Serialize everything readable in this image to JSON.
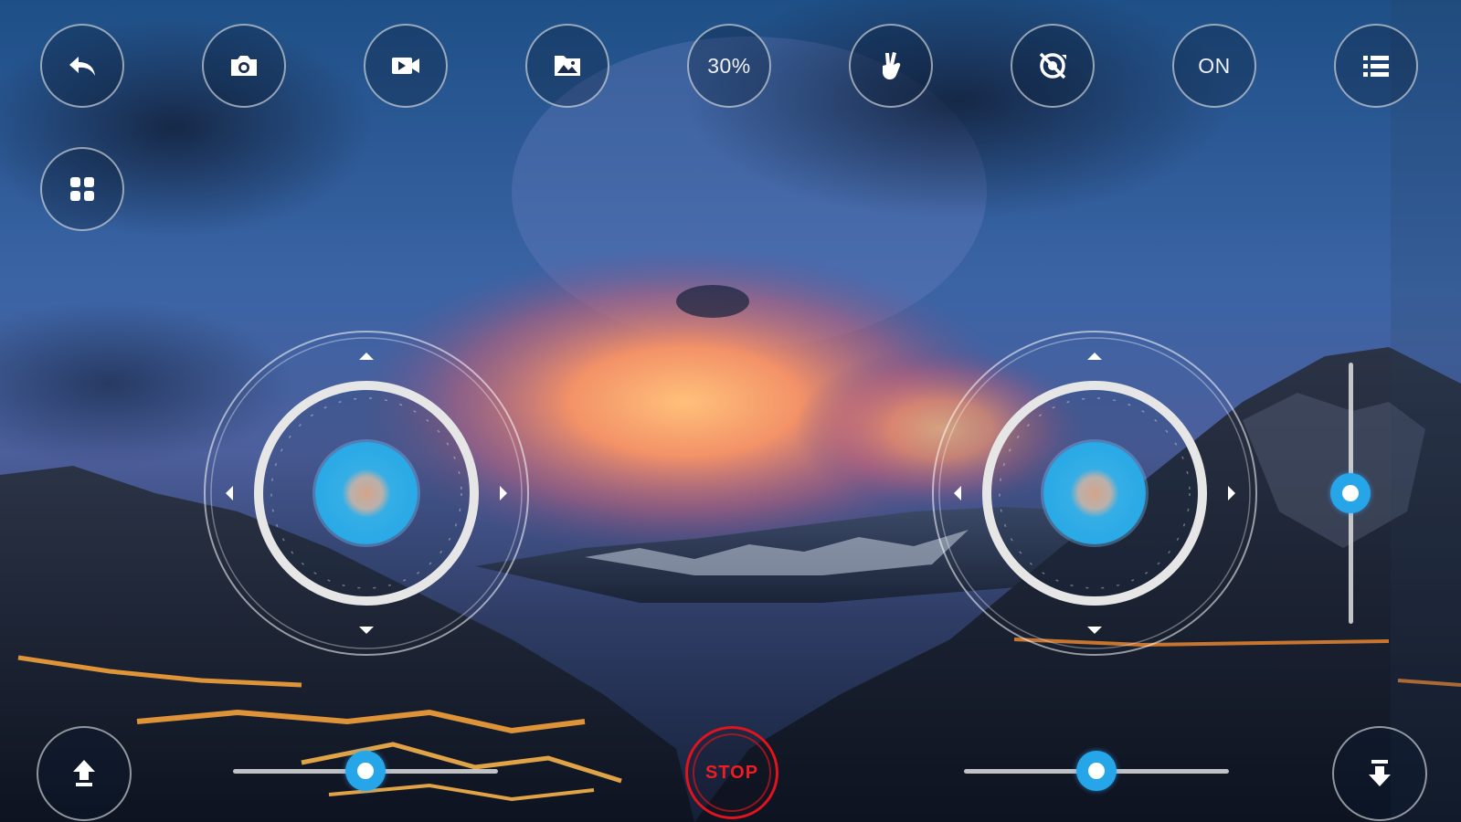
{
  "toolbar": {
    "back": {
      "icon": "back-arrow-icon"
    },
    "photo": {
      "icon": "camera-icon"
    },
    "video": {
      "icon": "video-camera-icon"
    },
    "gallery": {
      "icon": "gallery-folder-icon"
    },
    "speed": {
      "label": "30%"
    },
    "gesture": {
      "icon": "gesture-hand-icon"
    },
    "gyro": {
      "icon": "headless-mode-icon"
    },
    "power": {
      "label": "ON"
    },
    "menu": {
      "icon": "menu-list-icon"
    }
  },
  "side": {
    "grid": {
      "icon": "grid-apps-icon"
    }
  },
  "controls": {
    "takeoff": {
      "icon": "takeoff-up-icon"
    },
    "land": {
      "icon": "land-down-icon"
    },
    "stop": {
      "label": "STOP"
    },
    "left_trim_value": 0.5,
    "right_trim_value": 0.5,
    "vertical_trim_value": 0.5
  },
  "joysticks": {
    "left": {
      "x": 0,
      "y": 0
    },
    "right": {
      "x": 0,
      "y": 0
    }
  },
  "colors": {
    "accent": "#1fa5e6",
    "stop": "#e1131c",
    "ring": "#e6e6e6"
  }
}
